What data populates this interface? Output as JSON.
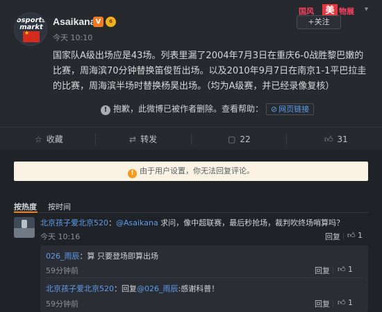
{
  "post": {
    "username": "Asaikana",
    "avatar_brand": "osports markt",
    "verified_badge": "V",
    "level_badge": "6",
    "time": "今天 10:10",
    "follow_label": "+关注",
    "banner_left": "国风",
    "banner_mid": "美",
    "banner_right": "物展",
    "content": "国家队A级出场应是43场。列表里漏了2004年7月3日在重庆6-0战胜黎巴嫩的比赛，周海滨70分钟替换笛俊哲出场。以及2010年9月7日在南京1-1平巴拉圭的比赛，周海滨半场时替换杨昊出场。（均为A级赛，并已经录像复核）",
    "deleted_text": "抱歉，此微博已被作者删除。查看帮助：",
    "deleted_link": "网页链接"
  },
  "actions": {
    "favorite": "收藏",
    "repost": "转发",
    "comment_count": "22",
    "like_count": "31"
  },
  "notice": "由于用户设置，你无法回复评论。",
  "sort": {
    "hot": "按热度",
    "time": "按时间"
  },
  "comment": {
    "user": "北京孩子爱北京520",
    "mention": "@Asaikana",
    "text": " 求问，像中超联赛，最后秒抢场，裁判吹终场哨算吗？",
    "time": "今天 10:16",
    "reply": "回复",
    "likes": "1"
  },
  "replies": [
    {
      "user": "026_雨辰",
      "text": "：算 只要登场即算出场",
      "time": "59分钟前",
      "reply": "回复",
      "likes": "1"
    },
    {
      "user": "北京孩子爱北京520",
      "text": "：回复",
      "mention": "@026_雨辰",
      "text2": ":感谢科普！",
      "time": "59分钟前",
      "reply": "回复",
      "likes": "1"
    }
  ],
  "icons": {
    "favorite": "star-icon",
    "repost": "repost-icon",
    "comment": "comment-icon",
    "like": "thumbs-up-icon",
    "info": "info-icon",
    "warning": "warning-icon",
    "link": "link-icon",
    "chevron": "chevron-down-icon"
  }
}
